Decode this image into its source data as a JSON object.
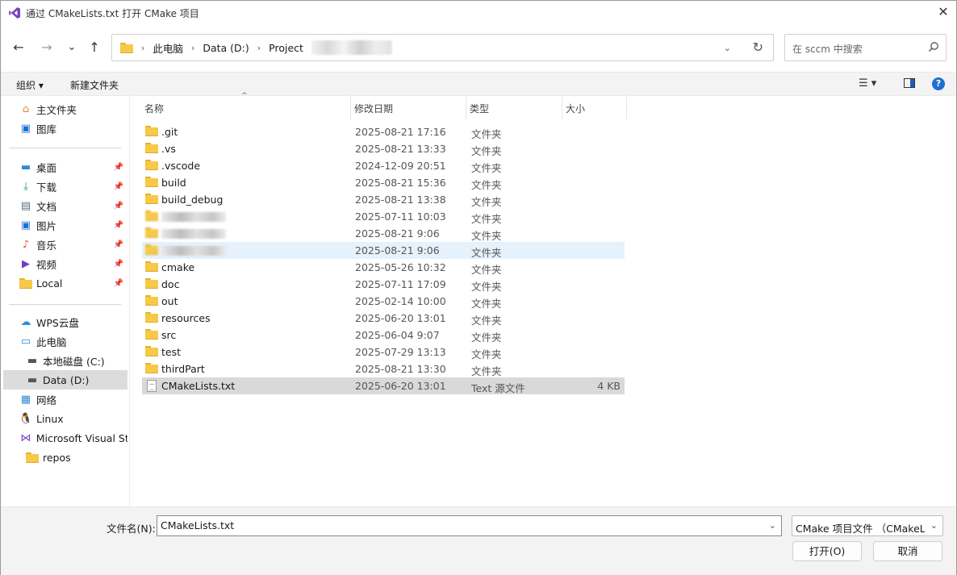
{
  "window": {
    "title": "通过 CMakeLists.txt 打开 CMake 项目",
    "close_glyph": "✕"
  },
  "nav": {
    "back_glyph": "←",
    "forward_glyph": "→",
    "recent_glyph": "⌄",
    "up_glyph": "↑"
  },
  "address": {
    "crumbs": [
      "此电脑",
      "Data (D:)",
      "Project"
    ],
    "separator": "›",
    "dropdown_glyph": "⌄",
    "refresh_glyph": "↻"
  },
  "search": {
    "placeholder": "在 sccm 中搜索",
    "icon": "search-icon"
  },
  "toolbar": {
    "organize_label": "组织 ▾",
    "new_folder_label": "新建文件夹",
    "views_glyph": "☰ ▾",
    "help_glyph": "?"
  },
  "sidebar": {
    "items": [
      {
        "label": "主文件夹",
        "icon": "home-icon",
        "glyph": "⌂",
        "color": "#d68a3a"
      },
      {
        "label": "图库",
        "icon": "gallery-icon",
        "glyph": "▣",
        "color": "#1f6fd3"
      },
      {
        "label": "桌面",
        "icon": "desktop-icon",
        "glyph": "▬",
        "color": "#2e8bd6",
        "pinned": true
      },
      {
        "label": "下载",
        "icon": "download-icon",
        "glyph": "⤓",
        "color": "#1f9a6a",
        "pinned": true
      },
      {
        "label": "文档",
        "icon": "documents-icon",
        "glyph": "▤",
        "color": "#5b6c80",
        "pinned": true
      },
      {
        "label": "图片",
        "icon": "pictures-icon",
        "glyph": "▣",
        "color": "#1f6fd3",
        "pinned": true
      },
      {
        "label": "音乐",
        "icon": "music-icon",
        "glyph": "♪",
        "color": "#e2563a",
        "pinned": true
      },
      {
        "label": "视频",
        "icon": "video-icon",
        "glyph": "▶",
        "color": "#6b3fc5",
        "pinned": true
      },
      {
        "label": "Local",
        "icon": "folder-icon",
        "glyph": "",
        "color": "#f7c948",
        "pinned": true
      },
      {
        "label": "WPS云盘",
        "icon": "cloud-icon",
        "glyph": "☁",
        "color": "#2a8de0"
      },
      {
        "label": "此电脑",
        "icon": "computer-icon",
        "glyph": "▭",
        "color": "#2e8bd6"
      },
      {
        "label": "本地磁盘 (C:)",
        "icon": "drive-c-icon",
        "glyph": "▬",
        "color": "#555555"
      },
      {
        "label": "Data (D:)",
        "icon": "drive-d-icon",
        "glyph": "▬",
        "color": "#555555"
      },
      {
        "label": "网络",
        "icon": "network-icon",
        "glyph": "▦",
        "color": "#2e8bd6"
      },
      {
        "label": "Linux",
        "icon": "linux-icon",
        "glyph": "🐧",
        "color": "#222222"
      },
      {
        "label": "Microsoft Visual St",
        "icon": "visual-studio-icon",
        "glyph": "⋈",
        "color": "#7b3fc5"
      },
      {
        "label": "repos",
        "icon": "folder-icon",
        "glyph": "",
        "color": "#f7c948"
      }
    ],
    "pin_glyph": "📌"
  },
  "columns": [
    "名称",
    "修改日期",
    "类型",
    "大小"
  ],
  "sort_glyph": "^",
  "files": [
    {
      "name": ".git",
      "date": "2025-08-21 17:16",
      "type": "文件夹",
      "size": "",
      "kind": "folder"
    },
    {
      "name": ".vs",
      "date": "2025-08-21 13:33",
      "type": "文件夹",
      "size": "",
      "kind": "folder"
    },
    {
      "name": ".vscode",
      "date": "2024-12-09 20:51",
      "type": "文件夹",
      "size": "",
      "kind": "folder"
    },
    {
      "name": "build",
      "date": "2025-08-21 15:36",
      "type": "文件夹",
      "size": "",
      "kind": "folder"
    },
    {
      "name": "build_debug",
      "date": "2025-08-21 13:38",
      "type": "文件夹",
      "size": "",
      "kind": "folder"
    },
    {
      "name": "",
      "date": "2025-07-11 10:03",
      "type": "文件夹",
      "size": "",
      "kind": "folder",
      "blurred": true
    },
    {
      "name": "",
      "date": "2025-08-21 9:06",
      "type": "文件夹",
      "size": "",
      "kind": "folder",
      "blurred": true
    },
    {
      "name": "",
      "date": "2025-08-21 9:06",
      "type": "文件夹",
      "size": "",
      "kind": "folder",
      "blurred": true,
      "state": "hover"
    },
    {
      "name": "cmake",
      "date": "2025-05-26 10:32",
      "type": "文件夹",
      "size": "",
      "kind": "folder"
    },
    {
      "name": "doc",
      "date": "2025-07-11 17:09",
      "type": "文件夹",
      "size": "",
      "kind": "folder"
    },
    {
      "name": "out",
      "date": "2025-02-14 10:00",
      "type": "文件夹",
      "size": "",
      "kind": "folder"
    },
    {
      "name": "resources",
      "date": "2025-06-20 13:01",
      "type": "文件夹",
      "size": "",
      "kind": "folder"
    },
    {
      "name": "src",
      "date": "2025-06-04 9:07",
      "type": "文件夹",
      "size": "",
      "kind": "folder"
    },
    {
      "name": "test",
      "date": "2025-07-29 13:13",
      "type": "文件夹",
      "size": "",
      "kind": "folder"
    },
    {
      "name": "thirdPart",
      "date": "2025-08-21 13:30",
      "type": "文件夹",
      "size": "",
      "kind": "folder"
    },
    {
      "name": "CMakeLists.txt",
      "date": "2025-06-20 13:01",
      "type": "Text 源文件",
      "size": "4 KB",
      "kind": "file",
      "state": "selected"
    }
  ],
  "bottom": {
    "filename_label": "文件名(N):",
    "filename_value": "CMakeLists.txt",
    "filter_value": "CMake 项目文件 （CMakeLis",
    "open_label": "打开(O)",
    "cancel_label": "取消",
    "chevron_glyph": "⌄"
  },
  "colors": {
    "accent": "#1f6fd3",
    "folder": "#f7c948",
    "selection": "#d9d9d9",
    "hover": "#e5f1fb"
  }
}
